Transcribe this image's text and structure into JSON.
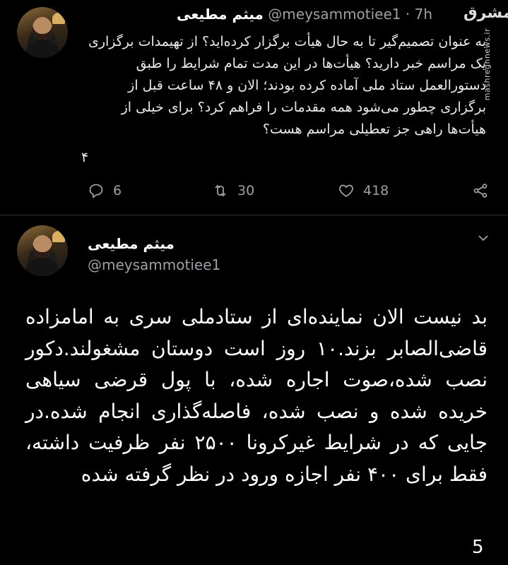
{
  "tweet1": {
    "name": "میثم مطیعی",
    "handle": "@meysammotiee1",
    "separator": "·",
    "time": "7h",
    "text": "به عنوان تصمیم‌گیر تا به حال هیأت برگزار کرده‌اید؟ از تهیمدات برگزاری یک مراسم خبر دارید؟ هیأت‌ها در این مدت تمام شرایط را طبق دستورالعمل ستاد ملی آماده کرده بودند؛ الان و ۴۸ ساعت قبل از برگزاری چطور می‌شود همه مقدمات را فراهم کرد؟ برای خیلی از هیأت‌ها راهی جز تعطیلی مراسم هست؟",
    "thread_number": "۴",
    "replies": "6",
    "retweets": "30",
    "likes": "418"
  },
  "tweet2": {
    "name": "میثم مطیعی",
    "handle": "@meysammotiee1",
    "text": "بد نیست الان نماینده‌ای از ستادملی سری به امامزاده قاضی‌الصابر بزند.۱۰ روز است دوستان مشغولند.دکور نصب شده،صوت اجاره شده، با پول قرضی سیاهی خریده شده و نصب شده، فاصله‌گذاری انجام شده.در جایی که در شرایط غیرکرونا ۲۵۰۰ نفر ظرفیت داشته، فقط برای ۴۰۰ نفر اجازه ورود در نظر گرفته شده",
    "thread_number": "5"
  },
  "watermark": {
    "logo": "مشرق",
    "site": "mashreghnews.ir"
  },
  "icons": {
    "reply": "reply-icon",
    "retweet": "retweet-icon",
    "like": "heart-icon",
    "share": "share-icon",
    "more": "chevron-down-icon"
  },
  "colors": {
    "background": "#000000",
    "text": "#ffffff",
    "muted": "#9aa0a6",
    "divider": "#2f3336"
  }
}
